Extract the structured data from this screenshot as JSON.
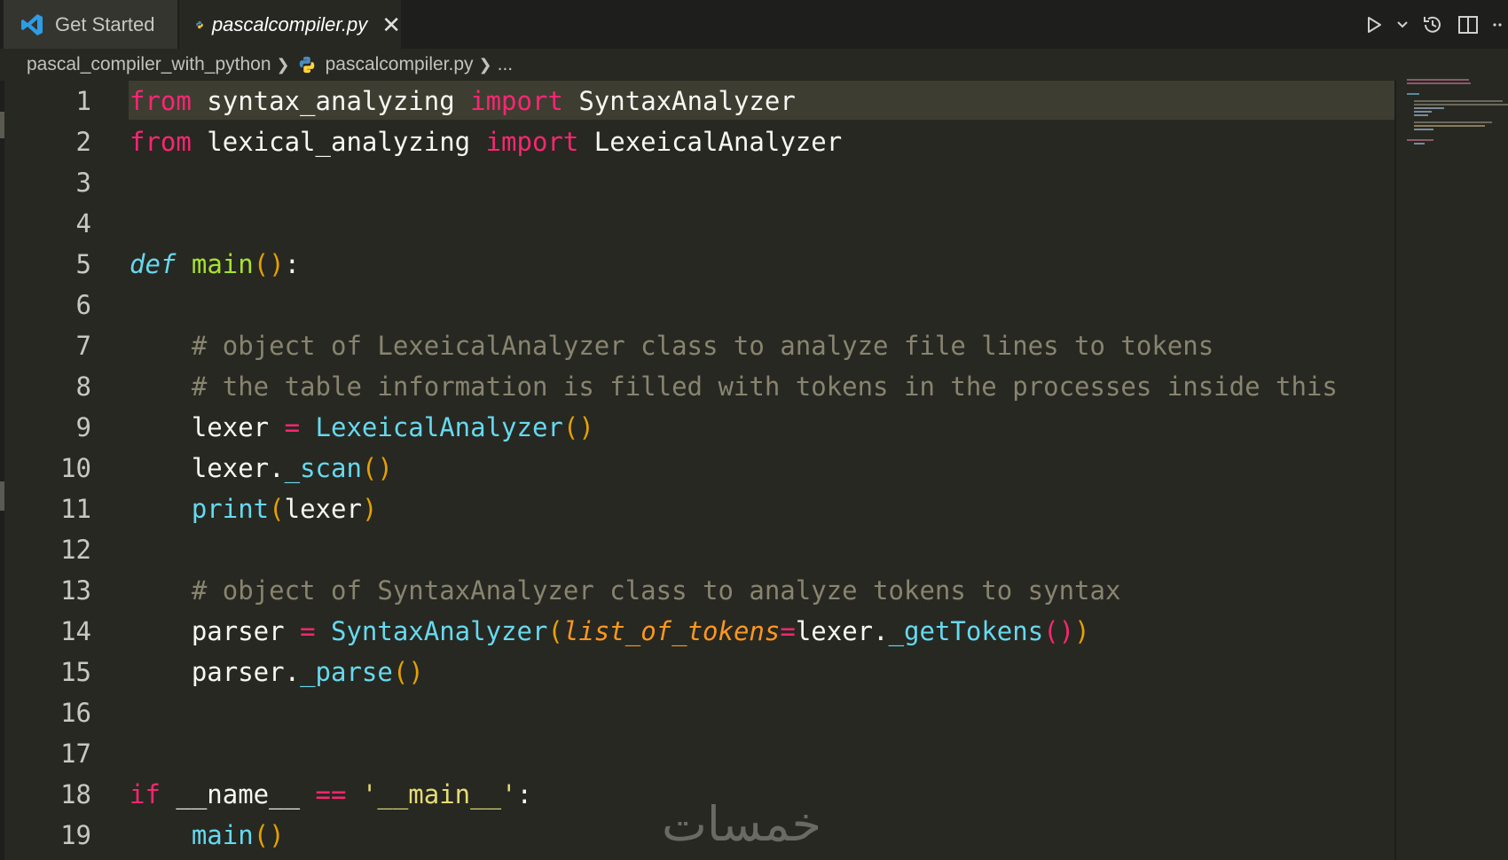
{
  "tabs": [
    {
      "label": "Get Started",
      "icon": "vscode-icon"
    },
    {
      "label": "pascalcompiler.py",
      "icon": "python-icon",
      "close": "✕",
      "active": true
    }
  ],
  "breadcrumb": {
    "folder": "pascal_compiler_with_python",
    "file": "pascalcompiler.py",
    "more": "..."
  },
  "editor_lines": [
    {
      "n": "1"
    },
    {
      "n": "2"
    },
    {
      "n": "3"
    },
    {
      "n": "4"
    },
    {
      "n": "5"
    },
    {
      "n": "6"
    },
    {
      "n": "7"
    },
    {
      "n": "8"
    },
    {
      "n": "9"
    },
    {
      "n": "10"
    },
    {
      "n": "11"
    },
    {
      "n": "12"
    },
    {
      "n": "13"
    },
    {
      "n": "14"
    },
    {
      "n": "15"
    },
    {
      "n": "16"
    },
    {
      "n": "17"
    },
    {
      "n": "18"
    },
    {
      "n": "19"
    }
  ],
  "code": {
    "l1": {
      "kw1": "from",
      "mod": " syntax_analyzing ",
      "kw2": "import",
      "name": " SyntaxAnalyzer"
    },
    "l2": {
      "kw1": "from",
      "mod": " lexical_analyzing ",
      "kw2": "import",
      "name": " LexeicalAnalyzer"
    },
    "l5": {
      "def": "def",
      "fn": "main",
      "paren": "()",
      "colon": ":"
    },
    "l7": "# object of LexeicalAnalyzer class to analyze file lines to tokens",
    "l8": "# the table information is filled with tokens in the processes inside this",
    "l9": {
      "var": "lexer ",
      "eq": "=",
      "cls": " LexeicalAnalyzer",
      "paren": "()"
    },
    "l10": {
      "obj": "lexer.",
      "fn": "_scan",
      "paren": "()"
    },
    "l11": {
      "fn": "print",
      "p1": "(",
      "arg": "lexer",
      "p2": ")"
    },
    "l13": "# object of SyntaxAnalyzer class to analyze tokens to syntax",
    "l14": {
      "var": "parser ",
      "eq": "=",
      "cls": " SyntaxAnalyzer",
      "p1": "(",
      "prm": "list_of_tokens",
      "eq2": "=",
      "obj": "lexer.",
      "fn": "_getTokens",
      "p2": "()",
      "p3": ")"
    },
    "l15": {
      "obj": "parser.",
      "fn": "_parse",
      "paren": "()"
    },
    "l18": {
      "kw": "if",
      "name": " __name__ ",
      "op": "==",
      "str": " '__main__'",
      "colon": ":"
    },
    "l19": {
      "fn": "main",
      "paren": "()"
    }
  },
  "watermark": "خمسات",
  "colors": {
    "background": "#272822",
    "keyword": "#f92672",
    "function": "#a6e22e",
    "class": "#66d9ef",
    "comment": "#88846f",
    "param": "#fd971f"
  },
  "toolbar_icons": [
    "run-icon",
    "run-dropdown-icon",
    "timeline-icon",
    "split-editor-icon",
    "more-actions-icon"
  ]
}
